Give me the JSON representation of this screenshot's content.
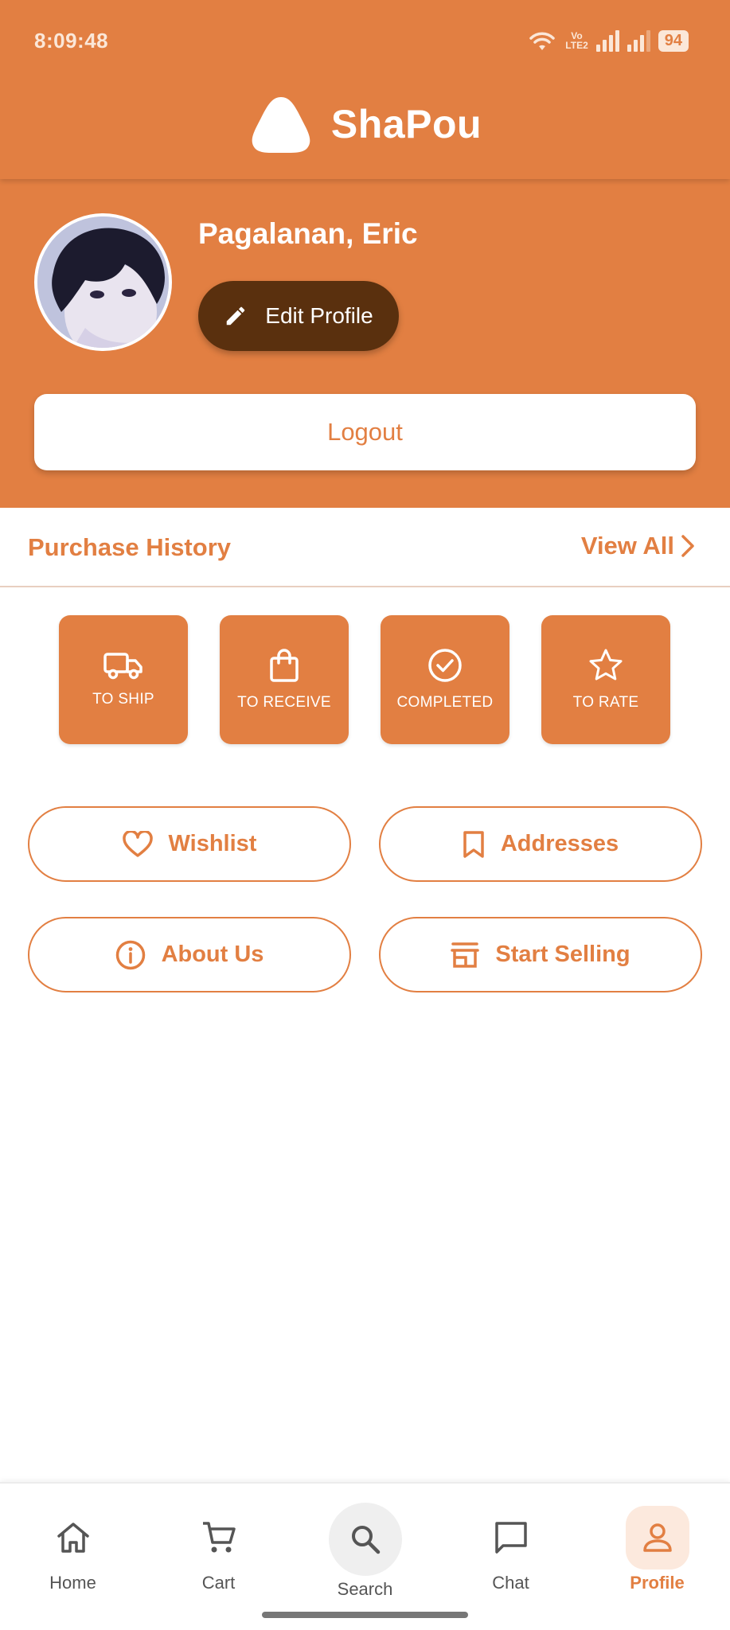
{
  "status_bar": {
    "time": "8:09:48",
    "battery": "94",
    "network": "Vo LTE2"
  },
  "app": {
    "name": "ShaPou"
  },
  "profile": {
    "user_name": "Pagalanan, Eric",
    "edit_label": "Edit Profile",
    "logout_label": "Logout"
  },
  "purchase_history": {
    "title": "Purchase History",
    "view_all": "View All",
    "statuses": [
      {
        "label": "TO SHIP",
        "icon": "truck-icon"
      },
      {
        "label": "TO RECEIVE",
        "icon": "shopping-bag-icon"
      },
      {
        "label": "COMPLETED",
        "icon": "check-circle-icon"
      },
      {
        "label": "TO RATE",
        "icon": "star-icon"
      }
    ]
  },
  "actions": {
    "wishlist": "Wishlist",
    "addresses": "Addresses",
    "about_us": "About Us",
    "start_selling": "Start Selling"
  },
  "nav": {
    "items": [
      {
        "label": "Home",
        "icon": "home-icon"
      },
      {
        "label": "Cart",
        "icon": "cart-icon"
      },
      {
        "label": "Search",
        "icon": "search-icon"
      },
      {
        "label": "Chat",
        "icon": "chat-icon"
      },
      {
        "label": "Profile",
        "icon": "person-icon",
        "active": true
      }
    ]
  },
  "colors": {
    "primary": "#E27F42",
    "edit_button": "#5a300e",
    "background": "#ffffff"
  }
}
